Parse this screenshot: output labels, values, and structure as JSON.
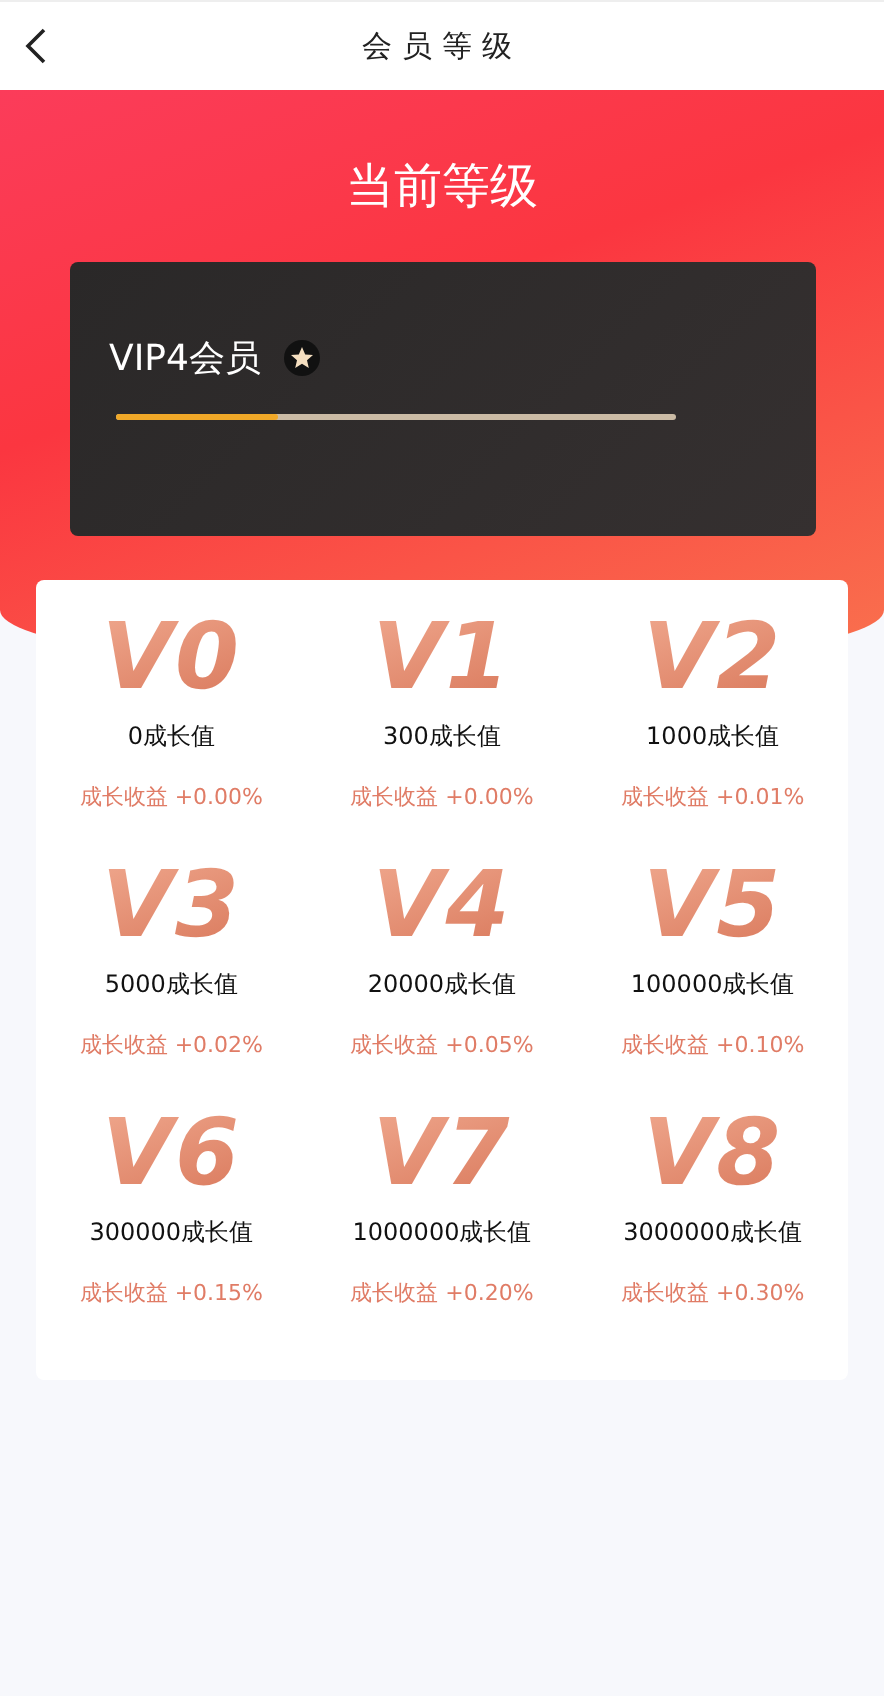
{
  "header": {
    "title": "会员等级"
  },
  "hero": {
    "title": "当前等级",
    "member_label": "VIP4会员",
    "level": 0.29
  },
  "levels": [
    {
      "badge": "V0",
      "growth": "0成长值",
      "bonus": "成长收益 +0.00%"
    },
    {
      "badge": "V1",
      "growth": "300成长值",
      "bonus": "成长收益 +0.00%"
    },
    {
      "badge": "V2",
      "growth": "1000成长值",
      "bonus": "成长收益 +0.01%"
    },
    {
      "badge": "V3",
      "growth": "5000成长值",
      "bonus": "成长收益 +0.02%"
    },
    {
      "badge": "V4",
      "growth": "20000成长值",
      "bonus": "成长收益 +0.05%"
    },
    {
      "badge": "V5",
      "growth": "100000成长值",
      "bonus": "成长收益 +0.10%"
    },
    {
      "badge": "V6",
      "growth": "300000成长值",
      "bonus": "成长收益 +0.15%"
    },
    {
      "badge": "V7",
      "growth": "1000000成长值",
      "bonus": "成长收益 +0.20%"
    },
    {
      "badge": "V8",
      "growth": "3000000成长值",
      "bonus": "成长收益 +0.30%"
    }
  ]
}
